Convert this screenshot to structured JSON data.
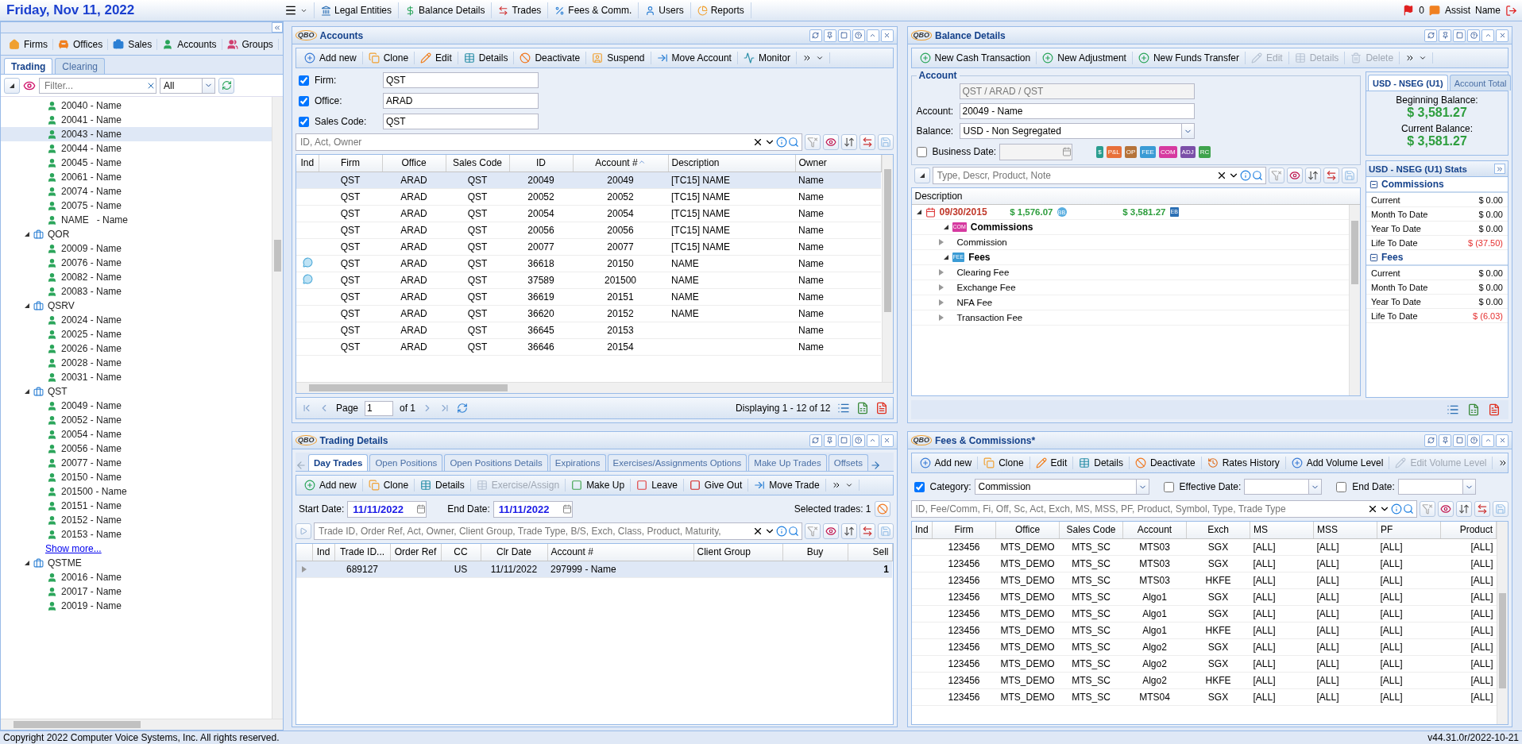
{
  "header": {
    "date": "Friday, Nov 11, 2022",
    "menu": [
      {
        "label": "Legal Entities"
      },
      {
        "label": "Balance Details"
      },
      {
        "label": "Trades"
      },
      {
        "label": "Fees & Comm."
      },
      {
        "label": "Users"
      },
      {
        "label": "Reports"
      }
    ],
    "flag_count": "0",
    "assist": "Assist",
    "user": "Name"
  },
  "left": {
    "entity_tabs": [
      "Firms",
      "Offices",
      "Sales",
      "Accounts",
      "Groups"
    ],
    "tabs": [
      {
        "label": "Trading",
        "selected": true
      },
      {
        "label": "Clearing",
        "selected": false
      }
    ],
    "filter": {
      "placeholder": "Filter..."
    },
    "scope": "All",
    "tree": [
      {
        "kind": "account",
        "label": "20040 - Name",
        "selected": false
      },
      {
        "kind": "account",
        "label": "20041 - Name",
        "selected": false
      },
      {
        "kind": "account",
        "label": "20043 - Name",
        "selected": true
      },
      {
        "kind": "account",
        "label": "20044 - Name",
        "selected": false
      },
      {
        "kind": "account",
        "label": "20045 - Name",
        "selected": false
      },
      {
        "kind": "account",
        "label": "20061 - Name",
        "selected": false
      },
      {
        "kind": "account",
        "label": "20074 - Name",
        "selected": false
      },
      {
        "kind": "account",
        "label": "20075 - Name",
        "selected": false
      },
      {
        "kind": "account",
        "label": "NAME   - Name",
        "selected": false
      },
      {
        "kind": "group",
        "label": "QOR",
        "expanded": true,
        "children": [
          {
            "kind": "account",
            "label": "20009 - Name",
            "selected": false
          },
          {
            "kind": "account",
            "label": "20076 - Name",
            "selected": false
          },
          {
            "kind": "account",
            "label": "20082 - Name",
            "selected": false
          },
          {
            "kind": "account",
            "label": "20083 - Name",
            "selected": false
          }
        ]
      },
      {
        "kind": "group",
        "label": "QSRV",
        "expanded": true,
        "children": [
          {
            "kind": "account",
            "label": "20024 - Name",
            "selected": false
          },
          {
            "kind": "account",
            "label": "20025 - Name",
            "selected": false
          },
          {
            "kind": "account",
            "label": "20026 - Name",
            "selected": false
          },
          {
            "kind": "account",
            "label": "20028 - Name",
            "selected": false
          },
          {
            "kind": "account",
            "label": "20031 - Name",
            "selected": false
          }
        ]
      },
      {
        "kind": "group",
        "label": "QST",
        "expanded": true,
        "children": [
          {
            "kind": "account",
            "label": "20049 - Name",
            "selected": false
          },
          {
            "kind": "account",
            "label": "20052 - Name",
            "selected": false
          },
          {
            "kind": "account",
            "label": "20054 - Name",
            "selected": false
          },
          {
            "kind": "account",
            "label": "20056 - Name",
            "selected": false
          },
          {
            "kind": "account",
            "label": "20077 - Name",
            "selected": false
          },
          {
            "kind": "account",
            "label": "20150 - Name",
            "selected": false
          },
          {
            "kind": "account",
            "label": "201500 - Name",
            "selected": false
          },
          {
            "kind": "account",
            "label": "20151 - Name",
            "selected": false
          },
          {
            "kind": "account",
            "label": "20152 - Name",
            "selected": false
          },
          {
            "kind": "account",
            "label": "20153 - Name",
            "selected": false
          },
          {
            "kind": "link",
            "label": "Show more..."
          }
        ]
      },
      {
        "kind": "group",
        "label": "QSTME",
        "expanded": true,
        "children": [
          {
            "kind": "account",
            "label": "20016 - Name",
            "selected": false
          },
          {
            "kind": "account",
            "label": "20017 - Name",
            "selected": false
          },
          {
            "kind": "account",
            "label": "20019 - Name",
            "selected": false
          }
        ]
      }
    ]
  },
  "accounts": {
    "logo": "QBO",
    "title": "Accounts",
    "toolbar": [
      {
        "label": "Add new",
        "disabled": false
      },
      {
        "label": "Clone",
        "disabled": false
      },
      {
        "label": "Edit",
        "disabled": false
      },
      {
        "label": "Details",
        "disabled": false
      },
      {
        "label": "Deactivate",
        "disabled": false
      },
      {
        "label": "Suspend",
        "disabled": false
      },
      {
        "label": "Move Account",
        "disabled": false
      },
      {
        "label": "Monitor",
        "disabled": false
      }
    ],
    "filters": [
      {
        "label": "Firm:",
        "checked": true,
        "value": "QST"
      },
      {
        "label": "Office:",
        "checked": true,
        "value": "ARAD"
      },
      {
        "label": "Sales Code:",
        "checked": true,
        "value": "QST"
      }
    ],
    "search": {
      "placeholder": "ID, Act, Owner"
    },
    "columns": [
      {
        "label": "Ind",
        "sorted": false
      },
      {
        "label": "Firm",
        "sorted": false
      },
      {
        "label": "Office",
        "sorted": false
      },
      {
        "label": "Sales Code",
        "sorted": false
      },
      {
        "label": "ID",
        "sorted": false
      },
      {
        "label": "Account #",
        "sorted": true
      },
      {
        "label": "Description",
        "sorted": false
      },
      {
        "label": "Owner",
        "sorted": false
      }
    ],
    "rows": [
      {
        "note": false,
        "selected": true,
        "cells": [
          "",
          "QST",
          "ARAD",
          "QST",
          "20049",
          "20049",
          "[TC15] NAME",
          "Name"
        ]
      },
      {
        "note": false,
        "selected": false,
        "cells": [
          "",
          "QST",
          "ARAD",
          "QST",
          "20052",
          "20052",
          "[TC15] NAME",
          "Name"
        ]
      },
      {
        "note": false,
        "selected": false,
        "cells": [
          "",
          "QST",
          "ARAD",
          "QST",
          "20054",
          "20054",
          "[TC15] NAME",
          "Name"
        ]
      },
      {
        "note": false,
        "selected": false,
        "cells": [
          "",
          "QST",
          "ARAD",
          "QST",
          "20056",
          "20056",
          "[TC15] NAME",
          "Name"
        ]
      },
      {
        "note": false,
        "selected": false,
        "cells": [
          "",
          "QST",
          "ARAD",
          "QST",
          "20077",
          "20077",
          "[TC15] NAME",
          "Name"
        ]
      },
      {
        "note": true,
        "selected": false,
        "cells": [
          "",
          "QST",
          "ARAD",
          "QST",
          "36618",
          "20150",
          "NAME",
          "Name"
        ]
      },
      {
        "note": true,
        "selected": false,
        "cells": [
          "",
          "QST",
          "ARAD",
          "QST",
          "37589",
          "201500",
          "NAME",
          "Name"
        ]
      },
      {
        "note": false,
        "selected": false,
        "cells": [
          "",
          "QST",
          "ARAD",
          "QST",
          "36619",
          "20151",
          "NAME",
          "Name"
        ]
      },
      {
        "note": false,
        "selected": false,
        "cells": [
          "",
          "QST",
          "ARAD",
          "QST",
          "36620",
          "20152",
          "NAME",
          "Name"
        ]
      },
      {
        "note": false,
        "selected": false,
        "cells": [
          "",
          "QST",
          "ARAD",
          "QST",
          "36645",
          "20153",
          "",
          "Name"
        ]
      },
      {
        "note": false,
        "selected": false,
        "cells": [
          "",
          "QST",
          "ARAD",
          "QST",
          "36646",
          "20154",
          "",
          "Name"
        ]
      }
    ],
    "pager": {
      "page_label": "Page",
      "page": "1",
      "of": "of 1",
      "displaying": "Displaying 1 - 12 of 12"
    }
  },
  "balance": {
    "logo": "QBO",
    "title": "Balance Details",
    "toolbar": [
      {
        "label": "New Cash Transaction",
        "disabled": false
      },
      {
        "label": "New Adjustment",
        "disabled": false
      },
      {
        "label": "New Funds Transfer",
        "disabled": false
      },
      {
        "label": "Edit",
        "disabled": true
      },
      {
        "label": "Details",
        "disabled": true
      },
      {
        "label": "Delete",
        "disabled": true
      }
    ],
    "account": {
      "legend": "Account",
      "path": "QST / ARAD / QST",
      "account_label": "Account:",
      "account": "20049 - Name",
      "balance_label": "Balance:",
      "balance": "USD - Non Segregated",
      "business_date_label": "Business Date:",
      "business_date_checked": false,
      "badges": [
        {
          "text": "$",
          "color": "#2a9d8f"
        },
        {
          "text": "P&L",
          "color": "#e8703a"
        },
        {
          "text": "OP",
          "color": "#b5733a"
        },
        {
          "text": "FEE",
          "color": "#3a9bd5"
        },
        {
          "text": "COM",
          "color": "#d63aa0"
        },
        {
          "text": "ADJ",
          "color": "#7b4fa8"
        },
        {
          "text": "RC",
          "color": "#3fa34d"
        }
      ]
    },
    "summary": {
      "tabs": [
        {
          "label": "USD - NSEG (U1)",
          "selected": true
        },
        {
          "label": "Account Total",
          "selected": false
        }
      ],
      "beginning_label": "Beginning Balance:",
      "beginning": "$ 3,581.27",
      "current_label": "Current Balance:",
      "current": "$ 3,581.27"
    },
    "search": {
      "placeholder": "Type, Descr, Product, Note"
    },
    "grid_header": "Description",
    "tree": [
      {
        "kind": "date",
        "label": "09/30/2015",
        "amount": "$ 1,576.07",
        "amount_tag": "BB",
        "total": "$ 3,581.27",
        "total_tag": "EB",
        "expanded": true,
        "children": [
          {
            "kind": "category",
            "label": "Commissions",
            "tag": "COM",
            "color": "#d63aa0",
            "expanded": true,
            "children": [
              {
                "kind": "item",
                "label": "Commission",
                "expanded": false
              }
            ]
          },
          {
            "kind": "category",
            "label": "Fees",
            "tag": "FEE",
            "color": "#3a9bd5",
            "expanded": true,
            "children": [
              {
                "kind": "item",
                "label": "Clearing Fee",
                "expanded": false
              },
              {
                "kind": "item",
                "label": "Exchange Fee",
                "expanded": false
              },
              {
                "kind": "item",
                "label": "NFA Fee",
                "expanded": false
              },
              {
                "kind": "item",
                "label": "Transaction Fee",
                "expanded": false
              }
            ]
          }
        ]
      }
    ],
    "stats": {
      "title": "USD - NSEG (U1) Stats",
      "sections": [
        {
          "title": "Commissions",
          "expanded": true,
          "rows": [
            {
              "label": "Current",
              "value": "$ 0.00",
              "negative": false
            },
            {
              "label": "Month To Date",
              "value": "$ 0.00",
              "negative": false
            },
            {
              "label": "Year To Date",
              "value": "$ 0.00",
              "negative": false
            },
            {
              "label": "Life To Date",
              "value": "$ (37.50)",
              "negative": true
            }
          ]
        },
        {
          "title": "Fees",
          "expanded": true,
          "rows": [
            {
              "label": "Current",
              "value": "$ 0.00",
              "negative": false
            },
            {
              "label": "Month To Date",
              "value": "$ 0.00",
              "negative": false
            },
            {
              "label": "Year To Date",
              "value": "$ 0.00",
              "negative": false
            },
            {
              "label": "Life To Date",
              "value": "$ (6.03)",
              "negative": true
            }
          ]
        }
      ]
    }
  },
  "trading": {
    "logo": "QBO",
    "title": "Trading Details",
    "tabs": [
      {
        "label": "Day Trades",
        "selected": true
      },
      {
        "label": "Open Positions",
        "selected": false
      },
      {
        "label": "Open Positions Details",
        "selected": false
      },
      {
        "label": "Expirations",
        "selected": false
      },
      {
        "label": "Exercises/Assignments Options",
        "selected": false
      },
      {
        "label": "Make Up Trades",
        "selected": false
      },
      {
        "label": "Offsets",
        "selected": false
      }
    ],
    "toolbar": [
      {
        "label": "Add new",
        "disabled": false
      },
      {
        "label": "Clone",
        "disabled": false
      },
      {
        "label": "Details",
        "disabled": false
      },
      {
        "label": "Exercise/Assign",
        "disabled": true
      },
      {
        "label": "Make Up",
        "disabled": false
      },
      {
        "label": "Leave",
        "disabled": false
      },
      {
        "label": "Give Out",
        "disabled": false
      },
      {
        "label": "Move Trade",
        "disabled": false
      }
    ],
    "start_label": "Start Date:",
    "start": "11/11/2022",
    "end_label": "End Date:",
    "end": "11/11/2022",
    "selected_trades": "Selected trades: 1",
    "search": {
      "placeholder": "Trade ID, Order Ref, Act, Owner, Client Group, Trade Type, B/S, Exch, Class, Product, Maturity,"
    },
    "columns": [
      "Ind",
      "Trade ID...",
      "Order Ref",
      "CC",
      "Clr Date",
      "Account #",
      "Client Group",
      "Buy",
      "Sell"
    ],
    "rows": [
      {
        "expanded": false,
        "selected": true,
        "cells": [
          "",
          "689127",
          "",
          "US",
          "11/11/2022",
          "297999 - Name",
          "",
          "",
          "1"
        ]
      }
    ]
  },
  "fees": {
    "logo": "QBO",
    "title": "Fees & Commissions*",
    "toolbar": [
      {
        "label": "Add new",
        "disabled": false
      },
      {
        "label": "Clone",
        "disabled": false
      },
      {
        "label": "Edit",
        "disabled": false
      },
      {
        "label": "Details",
        "disabled": false
      },
      {
        "label": "Deactivate",
        "disabled": false
      },
      {
        "label": "Rates History",
        "disabled": false
      },
      {
        "label": "Add Volume Level",
        "disabled": false
      },
      {
        "label": "Edit Volume Level",
        "disabled": true
      }
    ],
    "filters": [
      {
        "label": "Category:",
        "checked": true,
        "value": "Commission"
      },
      {
        "label": "Effective Date:",
        "checked": false
      },
      {
        "label": "End Date:",
        "checked": false
      }
    ],
    "search": {
      "placeholder": "ID, Fee/Comm, Fi, Off, Sc, Act, Exch, MS, MSS, PF, Product, Symbol, Type, Trade Type"
    },
    "columns": [
      "Ind",
      "Firm",
      "Office",
      "Sales Code",
      "Account",
      "Exch",
      "MS",
      "MSS",
      "PF",
      "Product"
    ],
    "rows": [
      [
        "",
        "123456",
        "MTS_DEMO",
        "MTS_SC",
        "MTS03",
        "SGX",
        "[ALL]",
        "[ALL]",
        "[ALL]",
        "[ALL]"
      ],
      [
        "",
        "123456",
        "MTS_DEMO",
        "MTS_SC",
        "MTS03",
        "SGX",
        "[ALL]",
        "[ALL]",
        "[ALL]",
        "[ALL]"
      ],
      [
        "",
        "123456",
        "MTS_DEMO",
        "MTS_SC",
        "MTS03",
        "HKFE",
        "[ALL]",
        "[ALL]",
        "[ALL]",
        "[ALL]"
      ],
      [
        "",
        "123456",
        "MTS_DEMO",
        "MTS_SC",
        "Algo1",
        "SGX",
        "[ALL]",
        "[ALL]",
        "[ALL]",
        "[ALL]"
      ],
      [
        "",
        "123456",
        "MTS_DEMO",
        "MTS_SC",
        "Algo1",
        "SGX",
        "[ALL]",
        "[ALL]",
        "[ALL]",
        "[ALL]"
      ],
      [
        "",
        "123456",
        "MTS_DEMO",
        "MTS_SC",
        "Algo1",
        "HKFE",
        "[ALL]",
        "[ALL]",
        "[ALL]",
        "[ALL]"
      ],
      [
        "",
        "123456",
        "MTS_DEMO",
        "MTS_SC",
        "Algo2",
        "SGX",
        "[ALL]",
        "[ALL]",
        "[ALL]",
        "[ALL]"
      ],
      [
        "",
        "123456",
        "MTS_DEMO",
        "MTS_SC",
        "Algo2",
        "SGX",
        "[ALL]",
        "[ALL]",
        "[ALL]",
        "[ALL]"
      ],
      [
        "",
        "123456",
        "MTS_DEMO",
        "MTS_SC",
        "Algo2",
        "HKFE",
        "[ALL]",
        "[ALL]",
        "[ALL]",
        "[ALL]"
      ],
      [
        "",
        "123456",
        "MTS_DEMO",
        "MTS_SC",
        "MTS04",
        "SGX",
        "[ALL]",
        "[ALL]",
        "[ALL]",
        "[ALL]"
      ]
    ]
  },
  "footer": {
    "copyright": "Copyright 2022 Computer Voice Systems, Inc. All rights reserved.",
    "version": "v44.31.0r/2022-10-21"
  }
}
